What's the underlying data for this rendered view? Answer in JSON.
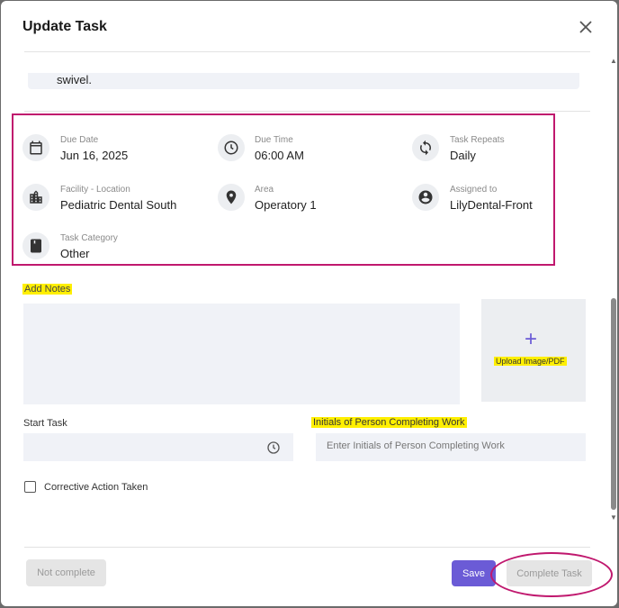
{
  "modal": {
    "title": "Update Task",
    "description_tail": "swivel."
  },
  "details": {
    "due_date": {
      "label": "Due Date",
      "value": "Jun 16, 2025",
      "icon": "calendar-icon"
    },
    "due_time": {
      "label": "Due Time",
      "value": "06:00 AM",
      "icon": "clock-icon"
    },
    "task_repeats": {
      "label": "Task Repeats",
      "value": "Daily",
      "icon": "repeat-icon"
    },
    "facility": {
      "label": "Facility - Location",
      "value": "Pediatric Dental South",
      "icon": "building-icon"
    },
    "area": {
      "label": "Area",
      "value": "Operatory 1",
      "icon": "location-pin-icon"
    },
    "assigned_to": {
      "label": "Assigned to",
      "value": "LilyDental-Front",
      "icon": "account-icon"
    },
    "task_category": {
      "label": "Task Category",
      "value": "Other",
      "icon": "book-icon"
    }
  },
  "form": {
    "add_notes_label": "Add Notes",
    "upload_label": "Upload Image/PDF",
    "start_task_label": "Start Task",
    "initials_label": "Initials of Person Completing Work",
    "initials_placeholder": "Enter Initials of Person Completing Work",
    "corrective_action_label": "Corrective Action Taken"
  },
  "footer": {
    "not_complete_label": "Not complete",
    "save_label": "Save",
    "complete_task_label": "Complete Task"
  },
  "colors": {
    "accent": "#6b5bd6",
    "annotation": "#c0186e",
    "highlight": "#ffef00"
  }
}
